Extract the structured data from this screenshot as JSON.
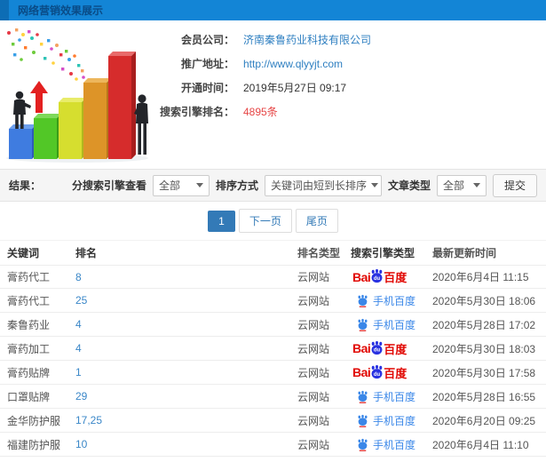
{
  "header": {
    "title": "网络营销效果展示"
  },
  "info": {
    "fields": [
      {
        "id": "member-company",
        "label": "会员公司：",
        "value": "济南秦鲁药业科技有限公司",
        "type": "link"
      },
      {
        "id": "promo-url",
        "label": "推广地址：",
        "value": "http://www.qlyyjt.com",
        "type": "link"
      },
      {
        "id": "open-time",
        "label": "开通时间：",
        "value": "2019年5月27日 09:17",
        "type": "text"
      },
      {
        "id": "engine-rank",
        "label": "搜索引擎排名：",
        "value": "4895",
        "unit": "条",
        "type": "highlight"
      }
    ]
  },
  "filters": {
    "result_label": "结果：",
    "engine_label": "分搜索引擎查看",
    "engine_value": "全部",
    "sort_label": "排序方式",
    "sort_value": "关键词由短到长排序",
    "article_label": "文章类型",
    "article_value": "全部",
    "submit_label": "提交"
  },
  "pagination": {
    "current": "1",
    "next": "下一页",
    "last": "尾页"
  },
  "table": {
    "headers": [
      "关键词",
      "排名",
      "排名类型",
      "搜索引擎类型",
      "最新更新时间"
    ],
    "header_ids": [
      "keyword",
      "rank",
      "rank-type",
      "engine-type",
      "updated"
    ],
    "rows": [
      {
        "keyword": "膏药代工",
        "rank": "8",
        "rank_type": "云网站",
        "engine": "baidu",
        "updated": "2020年6月4日 11:15"
      },
      {
        "keyword": "膏药代工",
        "rank": "25",
        "rank_type": "云网站",
        "engine": "mobile-baidu",
        "updated": "2020年5月30日 18:06"
      },
      {
        "keyword": "秦鲁药业",
        "rank": "4",
        "rank_type": "云网站",
        "engine": "mobile-baidu",
        "updated": "2020年5月28日 17:02"
      },
      {
        "keyword": "膏药加工",
        "rank": "4",
        "rank_type": "云网站",
        "engine": "baidu",
        "updated": "2020年5月30日 18:03"
      },
      {
        "keyword": "膏药贴牌",
        "rank": "1",
        "rank_type": "云网站",
        "engine": "baidu",
        "updated": "2020年5月30日 17:58"
      },
      {
        "keyword": "口罩贴牌",
        "rank": "29",
        "rank_type": "云网站",
        "engine": "mobile-baidu",
        "updated": "2020年5月28日 16:55"
      },
      {
        "keyword": "金华防护服",
        "rank": "17,25",
        "rank_type": "云网站",
        "engine": "mobile-baidu",
        "updated": "2020年6月20日 09:25"
      },
      {
        "keyword": "福建防护服",
        "rank": "10",
        "rank_type": "云网站",
        "engine": "mobile-baidu",
        "updated": "2020年6月4日 11:10"
      }
    ],
    "engines": {
      "baidu": {
        "bai": "Bai",
        "du": "du",
        "cn": "百度"
      },
      "mobile-baidu": {
        "label": "手机百度"
      }
    }
  },
  "colors": {
    "topbar_blue": "#1385d6",
    "title_blue": "#0a4b86",
    "link_blue": "#2e7fc1",
    "rank_link_blue": "#3a87c8",
    "highlight_red": "#e64545",
    "pagination_active": "#337ab7",
    "baidu_red": "#e10601",
    "baidu_blue": "#2932e1",
    "mobile_baidu_blue": "#3a87e8",
    "filter_bar_bg": "#f5f5f5"
  }
}
